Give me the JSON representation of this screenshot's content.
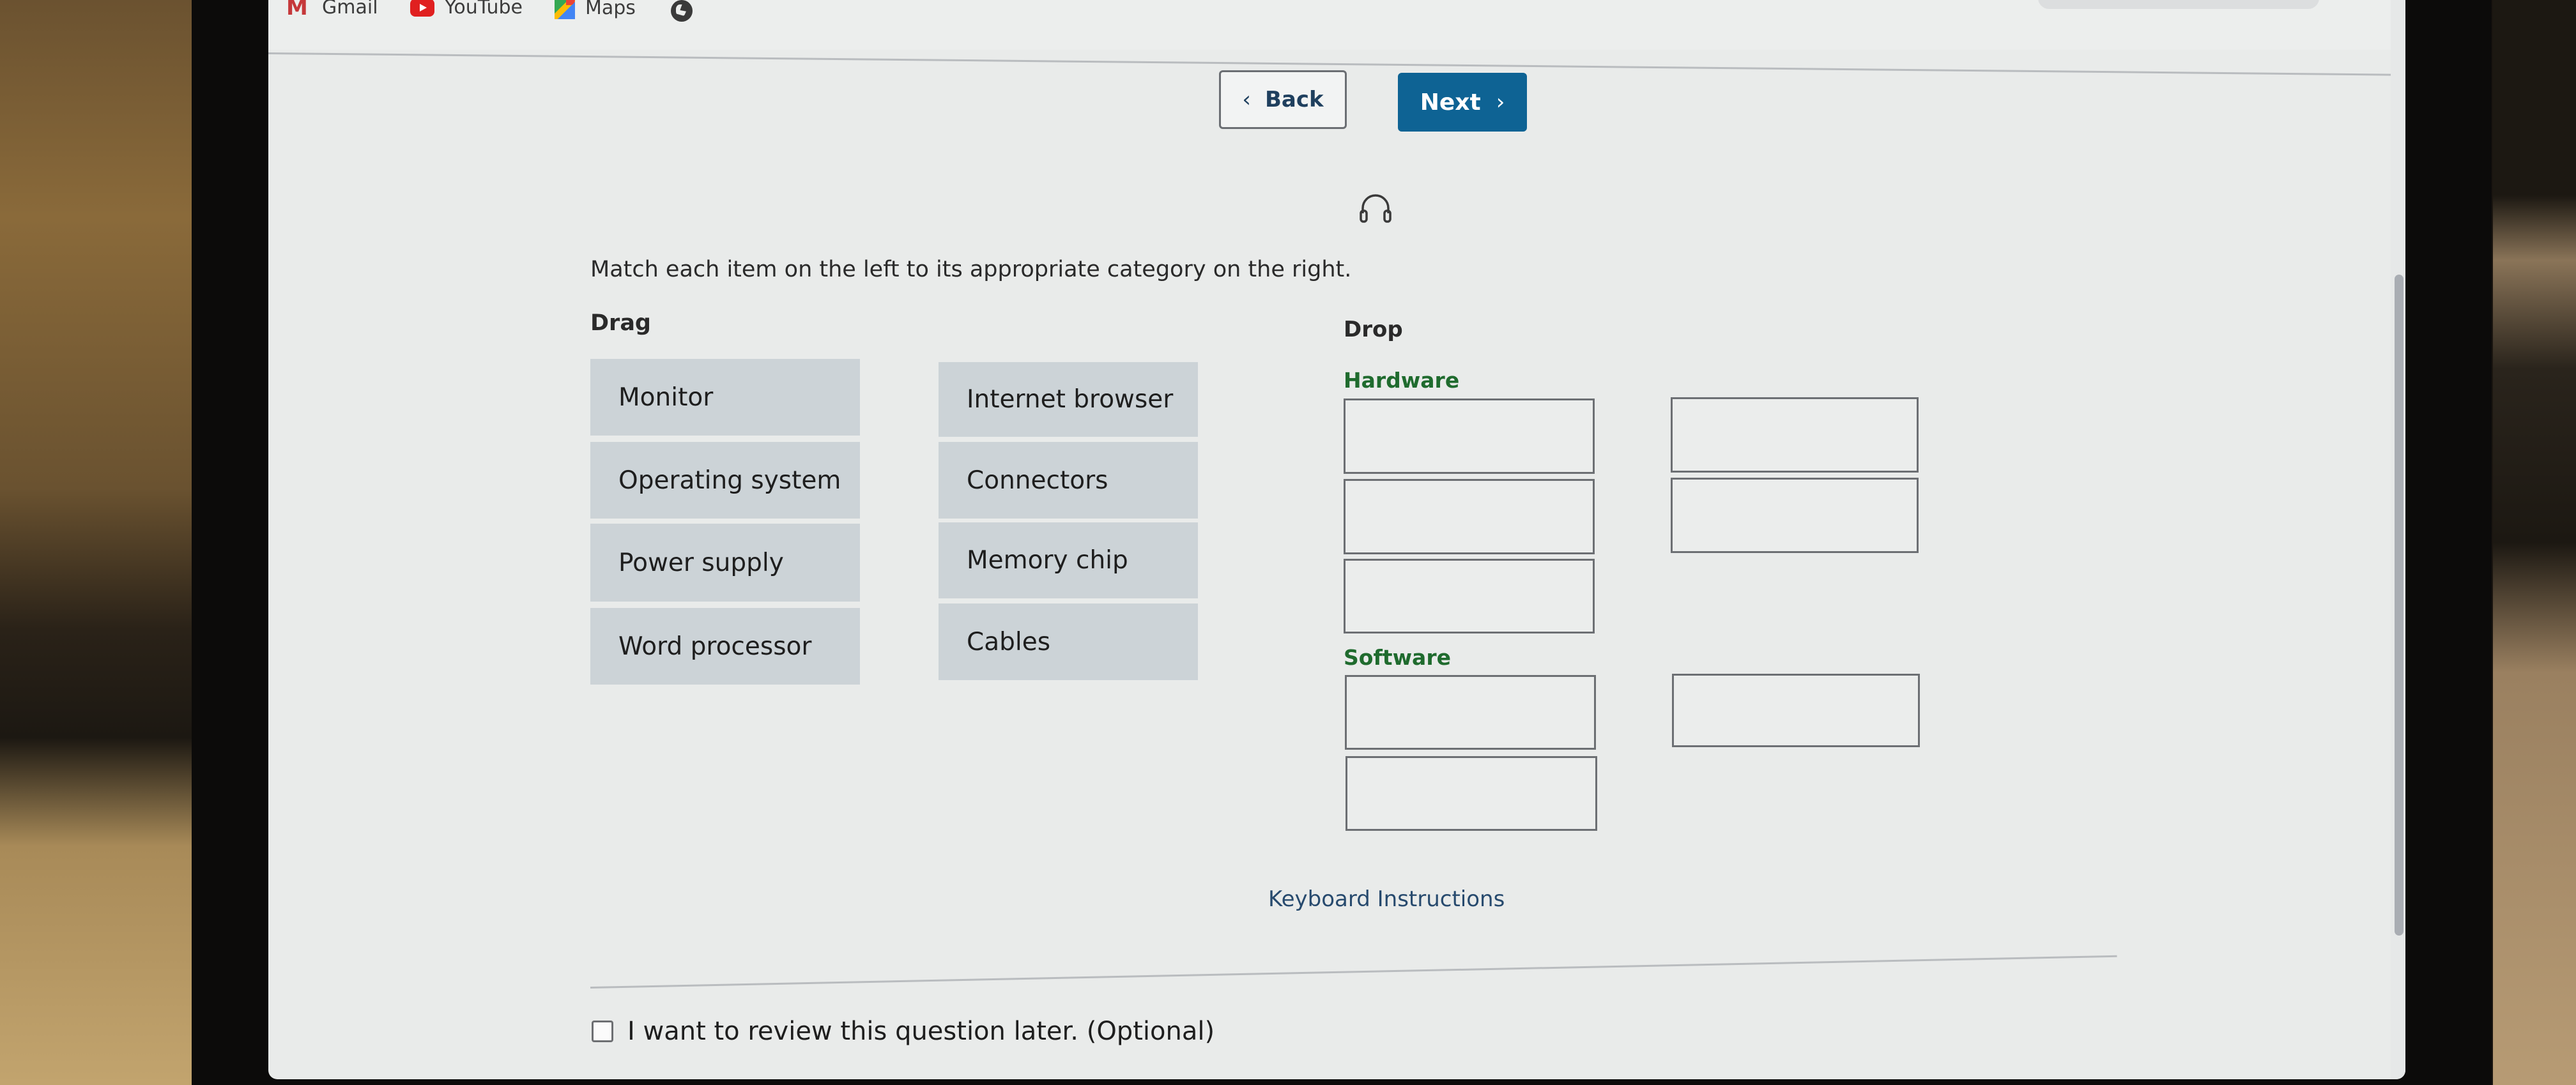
{
  "bookmarks": [
    {
      "label": "Gmail",
      "icon": "gmail-icon"
    },
    {
      "label": "YouTube",
      "icon": "youtube-icon"
    },
    {
      "label": "Maps",
      "icon": "maps-icon"
    },
    {
      "label": "",
      "icon": "globe-icon"
    }
  ],
  "nav": {
    "back_label": "Back",
    "next_label": "Next",
    "back_chevron": "‹",
    "next_chevron": "›",
    "next_color": "#0e6394"
  },
  "audio": {
    "icon": "headphones-icon"
  },
  "question": {
    "instruction": "Match each item on the left to its appropriate category on the right.",
    "drag_heading": "Drag",
    "drop_heading": "Drop"
  },
  "drag_items": [
    "Monitor",
    "Operating system",
    "Power supply",
    "Word processor",
    "Internet browser",
    "Connectors",
    "Memory chip",
    "Cables"
  ],
  "categories": [
    {
      "label": "Hardware",
      "slots": 5,
      "color": "#1f6b2e"
    },
    {
      "label": "Software",
      "slots": 3,
      "color": "#1f6b2e"
    }
  ],
  "keyboard_instructions": "Keyboard Instructions",
  "review": {
    "label": "I want to review this question later. (Optional)",
    "checked": false
  }
}
